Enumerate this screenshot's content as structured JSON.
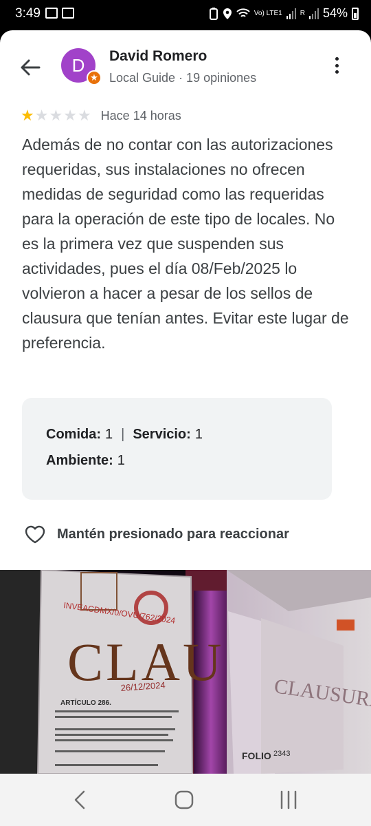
{
  "status_bar": {
    "time": "3:49",
    "network": "Vo) LTE1",
    "roaming": "R",
    "battery": "54%"
  },
  "review": {
    "avatar_letter": "D",
    "reviewer_name": "David Romero",
    "reviewer_meta": "Local Guide · 19 opiniones",
    "rating": 1,
    "max_rating": 5,
    "time_ago": "Hace 14 horas",
    "text": "Además de no contar con las autorizaciones requeridas, sus instalaciones no ofrecen medidas de seguridad como las requeridas para la operación de este tipo de locales. No es la primera vez que suspenden sus actividades, pues el día 08/Feb/2025 lo volvieron a hacer a pesar de los sellos de clausura que tenían antes. Evitar este lugar de preferencia.",
    "attributes": {
      "food_label": "Comida:",
      "food_value": "1",
      "service_label": "Servicio:",
      "service_value": "1",
      "ambience_label": "Ambiente:",
      "ambience_value": "1"
    },
    "react_label": "Mantén presionado para reaccionar"
  },
  "photo": {
    "seal_letters": "CLAU",
    "seal_right": "CLAUSURADO",
    "date_text": "26/12/2024",
    "article_text": "ARTÍCULO 286.",
    "folio_text": "FOLIO",
    "number_text": "2343"
  },
  "colors": {
    "avatar": "#a142c9",
    "star_on": "#fbbc04",
    "star_off": "#dadce0",
    "badge": "#e8710a"
  }
}
